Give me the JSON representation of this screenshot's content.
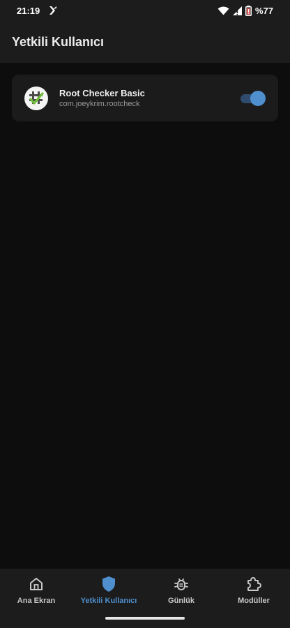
{
  "status_bar": {
    "time": "21:19",
    "battery": "%77",
    "icons": [
      "notification-app-icon",
      "wifi-icon",
      "signal-icon",
      "battery-icon"
    ]
  },
  "app_bar": {
    "title": "Yetkili Kullanıcı"
  },
  "apps": [
    {
      "name": "Root Checker Basic",
      "package": "com.joeykrim.rootcheck",
      "enabled": true
    }
  ],
  "bottom_nav": {
    "items": [
      {
        "label": "Ana Ekran",
        "icon": "home-icon",
        "active": false
      },
      {
        "label": "Yetkili Kullanıcı",
        "icon": "shield-icon",
        "active": true
      },
      {
        "label": "Günlük",
        "icon": "bug-icon",
        "active": false
      },
      {
        "label": "Modüller",
        "icon": "puzzle-icon",
        "active": false
      }
    ]
  },
  "colors": {
    "accent": "#4f8fce",
    "background": "#0d0d0d",
    "surface": "#1c1c1c",
    "card": "#1b1b1b"
  }
}
